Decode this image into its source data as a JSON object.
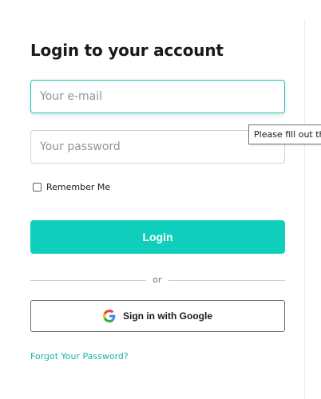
{
  "login": {
    "title": "Login to your account",
    "email_placeholder": "Your e-mail",
    "password_placeholder": "Your password",
    "validation_tooltip": "Please fill out this field.",
    "remember_label": "Remember Me",
    "remember_checked": false,
    "login_button": "Login",
    "divider_text": "or",
    "google_button": "Sign in with Google",
    "google_icon": "google-g-icon",
    "forgot_link": "Forgot Your Password?"
  },
  "colors": {
    "accent": "#0fcfbc",
    "link": "#14b8a6",
    "focus_border": "#18c7b5"
  }
}
